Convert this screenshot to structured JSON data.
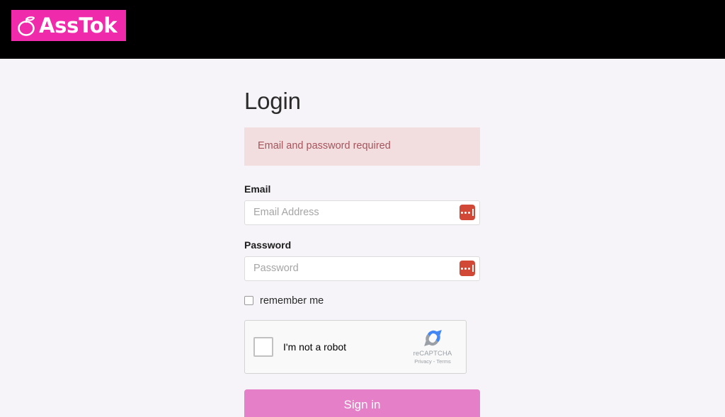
{
  "header": {
    "background_color": "#000000",
    "logo": {
      "icon": "peach-outline-icon",
      "text": "AssTok",
      "background_color": "#ef2bab",
      "text_color": "#ffffff"
    }
  },
  "page": {
    "background_color": "#f6f4f8",
    "title": "Login"
  },
  "alert": {
    "message": "Email and password required",
    "background_color": "#f2dede",
    "text_color": "#a6545c"
  },
  "form": {
    "email": {
      "label": "Email",
      "placeholder": "Email Address",
      "value": "",
      "manager_icon": "password-manager-icon",
      "manager_icon_color": "#d14836"
    },
    "password": {
      "label": "Password",
      "placeholder": "Password",
      "value": "",
      "manager_icon": "password-manager-icon",
      "manager_icon_color": "#d14836"
    },
    "remember": {
      "label": "remember me",
      "checked": false
    },
    "submit": {
      "label": "Sign in",
      "background_color": "#e57fc8",
      "text_color": "#ffffff"
    }
  },
  "recaptcha": {
    "checkbox_label": "I'm not a robot",
    "checked": false,
    "brand_name": "reCAPTCHA",
    "privacy_label": "Privacy",
    "separator": "-",
    "terms_label": "Terms",
    "logo": "recaptcha-logo-icon",
    "logo_blue": "#4285f4",
    "logo_gray": "#9aa0a6"
  }
}
